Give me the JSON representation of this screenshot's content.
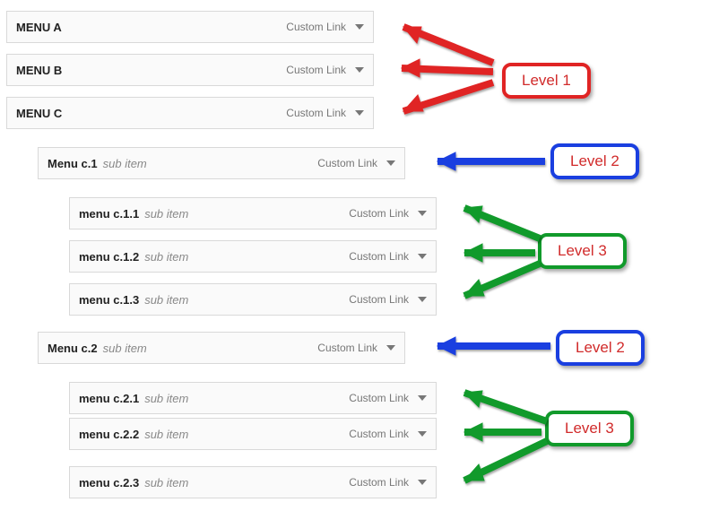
{
  "link_type_label": "Custom Link",
  "sub_item_label": "sub item",
  "menu": {
    "a": "MENU A",
    "b": "MENU B",
    "c": "MENU C",
    "c1": "Menu c.1",
    "c11": "menu c.1.1",
    "c12": "menu c.1.2",
    "c13": "menu c.1.3",
    "c2": "Menu c.2",
    "c21": "menu c.2.1",
    "c22": "menu c.2.2",
    "c23": "menu c.2.3"
  },
  "badges": {
    "level1": "Level 1",
    "level2": "Level 2",
    "level3": "Level 3"
  },
  "colors": {
    "red": "#e02424",
    "blue": "#1a3fe0",
    "green": "#119a2b"
  }
}
